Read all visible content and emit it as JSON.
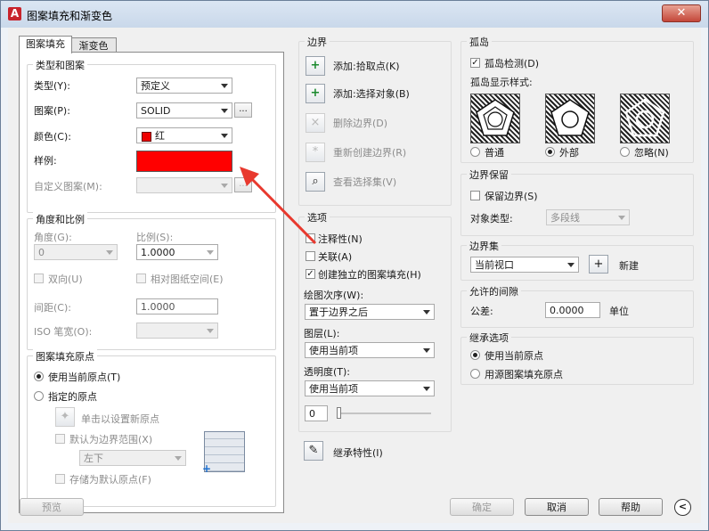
{
  "window": {
    "title": "图案填充和渐变色",
    "close_glyph": "✕"
  },
  "tabs": [
    {
      "label": "图案填充"
    },
    {
      "label": "渐变色"
    }
  ],
  "type_pattern": {
    "group_label": "类型和图案",
    "type_label": "类型(Y):",
    "type_value": "预定义",
    "pattern_label": "图案(P):",
    "pattern_value": "SOLID",
    "color_label": "颜色(C):",
    "color_value": "红",
    "sample_label": "样例:",
    "custom_label": "自定义图案(M):",
    "dots": "...",
    "sample_color": "#ff0000"
  },
  "angle_scale": {
    "group_label": "角度和比例",
    "angle_label": "角度(G):",
    "angle_value": "0",
    "scale_label": "比例(S):",
    "scale_value": "1.0000",
    "double_label": "双向(U)",
    "relative_label": "相对图纸空间(E)",
    "spacing_label": "间距(C):",
    "spacing_value": "1.0000",
    "iso_label": "ISO 笔宽(O):"
  },
  "origin": {
    "group_label": "图案填充原点",
    "use_current": "使用当前原点(T)",
    "specified": "指定的原点",
    "click_set": "单击以设置新原点",
    "default_extent": "默认为边界范围(X)",
    "position_value": "左下",
    "store_default": "存储为默认原点(F)"
  },
  "boundary": {
    "group_label": "边界",
    "add_pick": "添加:拾取点(K)",
    "add_select": "添加:选择对象(B)",
    "remove": "删除边界(D)",
    "recreate": "重新创建边界(R)",
    "view": "查看选择集(V)"
  },
  "options": {
    "group_label": "选项",
    "annotative": "注释性(N)",
    "associative": "关联(A)",
    "separate": "创建独立的图案填充(H)",
    "draw_order_label": "绘图次序(W):",
    "draw_order_value": "置于边界之后",
    "layer_label": "图层(L):",
    "layer_value": "使用当前项",
    "transparency_label": "透明度(T):",
    "transparency_value": "使用当前项",
    "transparency_amount": "0",
    "transparency_fraction": 0
  },
  "inherit_btn": "继承特性(I)",
  "islands": {
    "group_label": "孤岛",
    "detect": "孤岛检测(D)",
    "style_label": "孤岛显示样式:",
    "normal": "普通",
    "outer": "外部",
    "ignore": "忽略(N)"
  },
  "retain": {
    "group_label": "边界保留",
    "keep": "保留边界(S)",
    "object_type_label": "对象类型:",
    "object_type_value": "多段线"
  },
  "boundary_set": {
    "group_label": "边界集",
    "value": "当前视口",
    "new_label": "新建"
  },
  "gap": {
    "group_label": "允许的间隙",
    "tolerance_label": "公差:",
    "tolerance_value": "0.0000",
    "unit_label": "单位"
  },
  "inherit_opts": {
    "group_label": "继承选项",
    "use_current": "使用当前原点",
    "use_source": "用源图案填充原点"
  },
  "footer": {
    "preview": "预览",
    "ok": "确定",
    "cancel": "取消",
    "help": "帮助",
    "collapse_glyph": "<"
  },
  "icons": {
    "add_pick": "+",
    "add_select": "+",
    "remove": "×",
    "recreate": "*",
    "view": "⌕",
    "inherit": "✎",
    "origin": "✦",
    "new_set": "+",
    "check": "✓"
  }
}
